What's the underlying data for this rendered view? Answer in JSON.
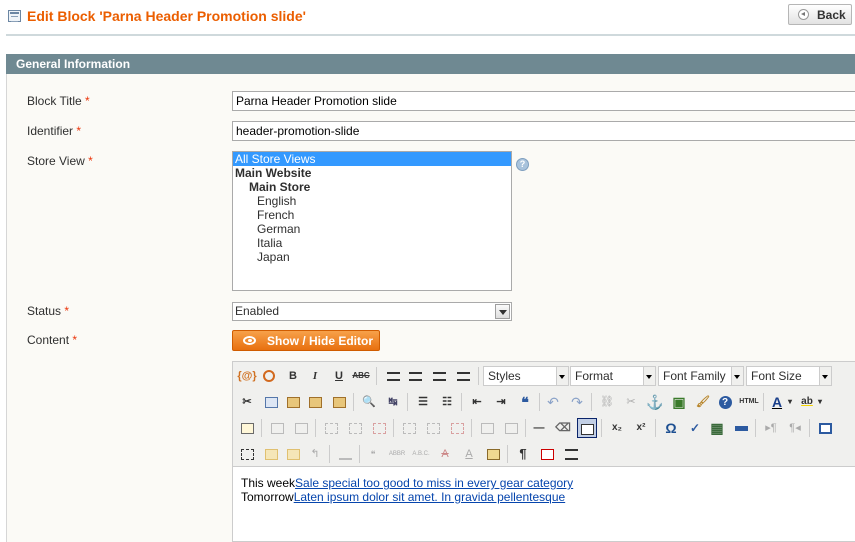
{
  "header": {
    "title": "Edit Block 'Parna Header Promotion slide'",
    "back_label": "Back"
  },
  "section": {
    "title": "General Information"
  },
  "form": {
    "block_title": {
      "label": "Block Title",
      "required": "*",
      "value": "Parna Header Promotion slide"
    },
    "identifier": {
      "label": "Identifier",
      "required": "*",
      "value": "header-promotion-slide"
    },
    "store_view": {
      "label": "Store View",
      "required": "*",
      "options": [
        {
          "label": "All Store Views",
          "selected": true,
          "level": 0,
          "bold": false
        },
        {
          "label": "Main Website",
          "selected": false,
          "level": 0,
          "bold": true
        },
        {
          "label": "Main Store",
          "selected": false,
          "level": 1,
          "bold": true
        },
        {
          "label": "English",
          "selected": false,
          "level": 2,
          "bold": false
        },
        {
          "label": "French",
          "selected": false,
          "level": 2,
          "bold": false
        },
        {
          "label": "German",
          "selected": false,
          "level": 2,
          "bold": false
        },
        {
          "label": "Italia",
          "selected": false,
          "level": 2,
          "bold": false
        },
        {
          "label": "Japan",
          "selected": false,
          "level": 2,
          "bold": false
        }
      ],
      "help_glyph": "?"
    },
    "status": {
      "label": "Status",
      "required": "*",
      "value": "Enabled"
    },
    "content": {
      "label": "Content",
      "required": "*",
      "toggle_label": "Show / Hide Editor"
    }
  },
  "editor": {
    "dropdowns": {
      "styles": "Styles",
      "format": "Format",
      "font_family": "Font Family",
      "font_size": "Font Size"
    },
    "glyphs": {
      "widget": "{@}",
      "bold": "B",
      "italic": "I",
      "underline": "U",
      "strike": "ABC",
      "cut": "✂",
      "find": "🔍",
      "replace": "↹",
      "ul": "☰",
      "ol": "☷",
      "outdent": "⇤",
      "indent": "⇥",
      "quote": "❝",
      "undo": "↶",
      "redo": "↷",
      "link": "⛓",
      "unlink": "✂",
      "anchor": "⚓",
      "image": "▣",
      "cleanup": "🖌",
      "help": "?",
      "html": "HTML",
      "forecolor": "A",
      "backcolor": "ab",
      "hr": "—",
      "eraser": "⌫",
      "sub": "x₂",
      "sup": "x²",
      "charmap": "Ω",
      "spell": "✓",
      "media": "▦",
      "pagebreak": "¶",
      "nbsp": "¶",
      "abbr": "ABBR",
      "acronym": "A.B.C.",
      "ins": "A",
      "del": "A"
    },
    "lines": [
      {
        "prefix": "This week",
        "link": "Sale special too good to miss in every gear category"
      },
      {
        "prefix": "Tomorrow",
        "link": "Laten ipsum dolor sit amet. In gravida pellentesque"
      }
    ]
  }
}
